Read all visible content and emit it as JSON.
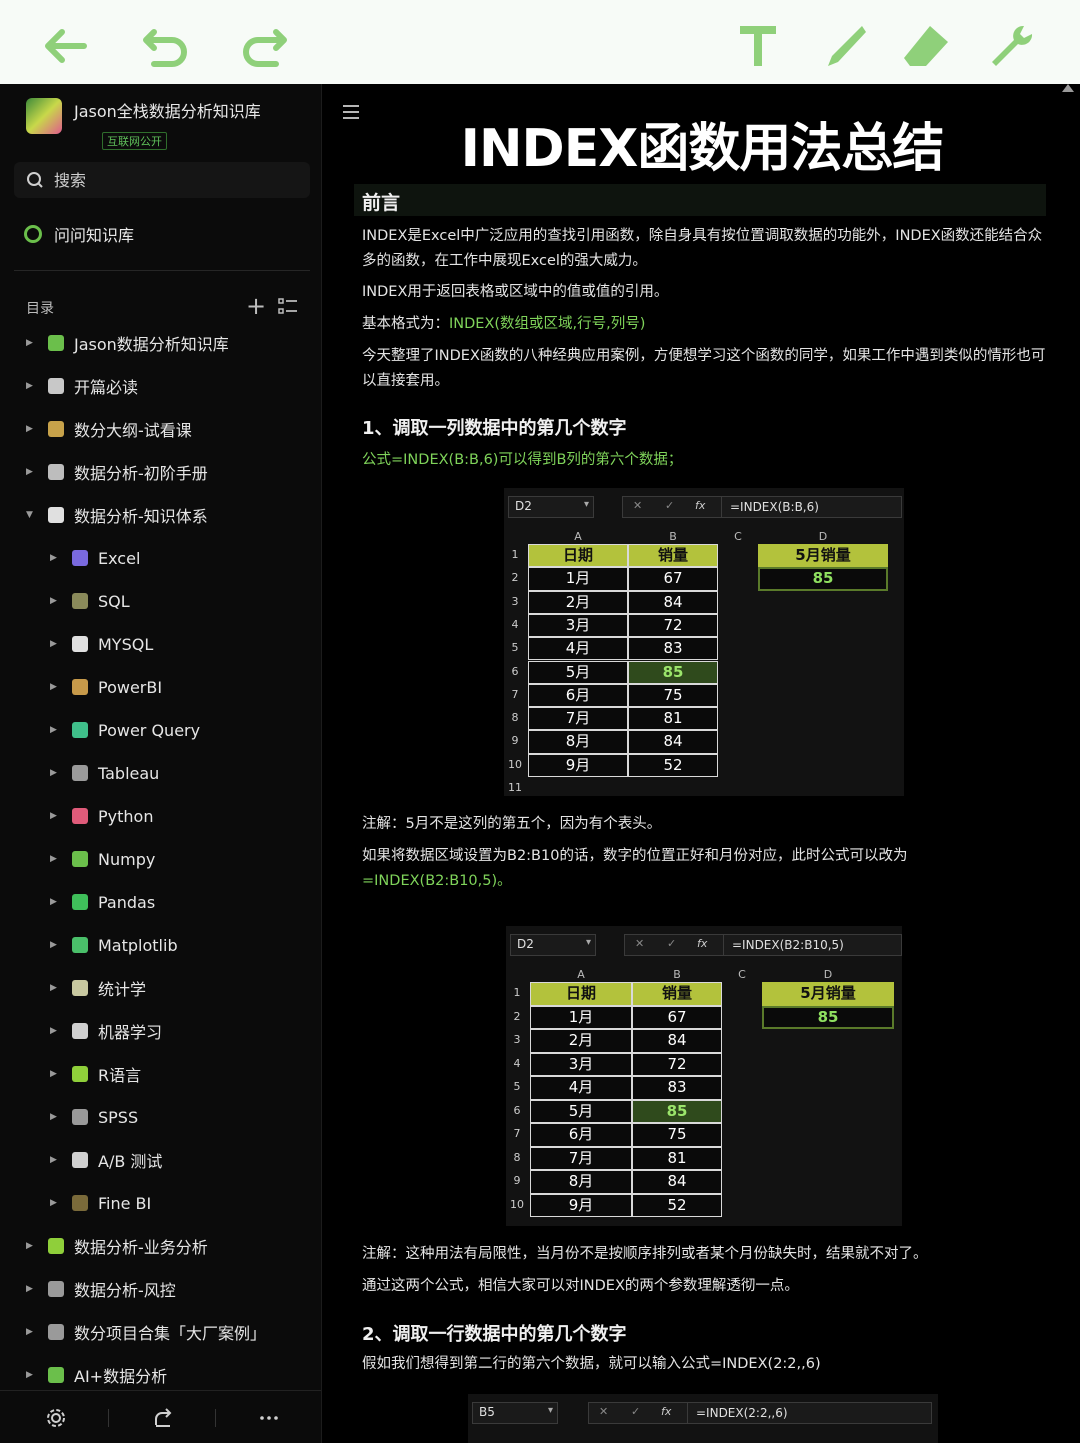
{
  "sidebar": {
    "kb_title": "Jason全栈数据分析知识库",
    "kb_badge": "互联网公开",
    "search_placeholder": "搜索",
    "ask_label": "问问知识库",
    "toc_label": "目录",
    "items": [
      {
        "label": "Jason数据分析知识库",
        "icon": "folder-icon",
        "color": "#6bbf4b",
        "expanded": false
      },
      {
        "label": "开篇必读",
        "icon": "note-icon",
        "color": "#c8c8c8",
        "expanded": false
      },
      {
        "label": "数分大纲-试看课",
        "icon": "gem-icon",
        "color": "#c7a24a",
        "expanded": false
      },
      {
        "label": "数据分析-初阶手册",
        "icon": "hourglass-icon",
        "color": "#bdbdbd",
        "expanded": false
      },
      {
        "label": "数据分析-知识体系",
        "icon": "music-icon",
        "color": "#e0e0e0",
        "expanded": true
      },
      {
        "label": "Excel",
        "icon": "excel-icon",
        "color": "#7a6adf",
        "child": true
      },
      {
        "label": "SQL",
        "icon": "sql-icon",
        "color": "#8a8a5a",
        "child": true
      },
      {
        "label": "MYSQL",
        "icon": "chat-icon",
        "color": "#e0e0e0",
        "child": true
      },
      {
        "label": "PowerBI",
        "icon": "gem-icon",
        "color": "#c79a4a",
        "child": true
      },
      {
        "label": "Power Query",
        "icon": "target-icon",
        "color": "#3fbf8a",
        "child": true
      },
      {
        "label": "Tableau",
        "icon": "link-icon",
        "color": "#9a9a9a",
        "child": true
      },
      {
        "label": "Python",
        "icon": "python-icon",
        "color": "#e05b7a",
        "child": true
      },
      {
        "label": "Numpy",
        "icon": "wrench-icon",
        "color": "#6bbf4b",
        "child": true
      },
      {
        "label": "Pandas",
        "icon": "pandas-icon",
        "color": "#3fbf5a",
        "child": true
      },
      {
        "label": "Matplotlib",
        "icon": "chart-icon",
        "color": "#4ac06a",
        "child": true
      },
      {
        "label": "统计学",
        "icon": "note-icon",
        "color": "#c8c8a0",
        "child": true
      },
      {
        "label": "机器学习",
        "icon": "robot-icon",
        "color": "#d0d0d0",
        "child": true
      },
      {
        "label": "R语言",
        "icon": "r-icon",
        "color": "#8fcf3a",
        "child": true
      },
      {
        "label": "SPSS",
        "icon": "pen-icon",
        "color": "#9a9a9a",
        "child": true
      },
      {
        "label": "A/B 测试",
        "icon": "ab-icon",
        "color": "#d0d0d0",
        "child": true
      },
      {
        "label": "Fine BI",
        "icon": "circle-icon",
        "color": "#7a6a3a",
        "child": true
      },
      {
        "label": "数据分析-业务分析",
        "icon": "medal-icon",
        "color": "#8fcf3a",
        "expanded": false
      },
      {
        "label": "数据分析-风控",
        "icon": "curve-icon",
        "color": "#9a9a9a",
        "expanded": false
      },
      {
        "label": "数分项目合集「大厂案例」",
        "icon": "link-icon",
        "color": "#9a9a9a",
        "expanded": false
      },
      {
        "label": "AI+数据分析",
        "icon": "ai-icon",
        "color": "#6bbf4b",
        "expanded": false
      }
    ]
  },
  "doc": {
    "title": "INDEX函数用法总结",
    "section1": "前言",
    "p1": "INDEX是Excel中广泛应用的查找引用函数，除自身具有按位置调取数据的功能外，INDEX函数还能结合众多的函数，在工作中展现Excel的强大威力。",
    "p2": "INDEX用于返回表格或区域中的值或值的引用。",
    "p3_prefix": "基本格式为：",
    "p3_formula": "INDEX(数组或区域,行号,列号)",
    "p4": "今天整理了INDEX函数的八种经典应用案例，方便想学习这个函数的同学，如果工作中遇到类似的情形也可以直接套用。",
    "h1": "1、调取一列数据中的第几个数字",
    "p5": "公式=INDEX(B:B,6)可以得到B列的第六个数据；",
    "note1": "注解：5月不是这列的第五个，因为有个表头。",
    "p6a": "如果将数据区域设置为B2:B10的话，数字的位置正好和月份对应，此时公式可以改为",
    "p6b": "=INDEX(B2:B10,5)。",
    "note2": "注解：这种用法有局限性，当月份不是按顺序排列或者某个月份缺失时，结果就不对了。",
    "p7": "通过这两个公式，相信大家可以对INDEX的两个参数理解透彻一点。",
    "h2": "2、调取一行数据中的第几个数字",
    "p8": "假如我们想得到第二行的第六个数据，就可以输入公式=INDEX(2:2,,6)"
  },
  "excel1": {
    "namebox": "D2",
    "formula": "=INDEX(B:B,6)",
    "cols": [
      "A",
      "B",
      "C",
      "D"
    ],
    "rows": [
      "1",
      "2",
      "3",
      "4",
      "5",
      "6",
      "7",
      "8",
      "9",
      "10",
      "11"
    ],
    "hdr_date": "日期",
    "hdr_sales": "销量",
    "months": [
      "1月",
      "2月",
      "3月",
      "4月",
      "5月",
      "6月",
      "7月",
      "8月",
      "9月"
    ],
    "sales": [
      "67",
      "84",
      "72",
      "83",
      "85",
      "75",
      "81",
      "84",
      "52"
    ],
    "d_header": "5月销量",
    "d_value": "85"
  },
  "excel2": {
    "namebox": "D2",
    "formula": "=INDEX(B2:B10,5)",
    "cols": [
      "A",
      "B",
      "C",
      "D"
    ],
    "rows": [
      "1",
      "2",
      "3",
      "4",
      "5",
      "6",
      "7",
      "8",
      "9",
      "10"
    ],
    "hdr_date": "日期",
    "hdr_sales": "销量",
    "months": [
      "1月",
      "2月",
      "3月",
      "4月",
      "5月",
      "6月",
      "7月",
      "8月",
      "9月"
    ],
    "sales": [
      "67",
      "84",
      "72",
      "83",
      "85",
      "75",
      "81",
      "84",
      "52"
    ],
    "d_header": "5月销量",
    "d_value": "85"
  },
  "excel3": {
    "namebox": "B5",
    "formula": "=INDEX(2:2,,6)"
  },
  "colors": {
    "accent_green": "#7fd35a",
    "excel_header": "#b3c23c",
    "toolbar_icon": "#8fd07a"
  }
}
